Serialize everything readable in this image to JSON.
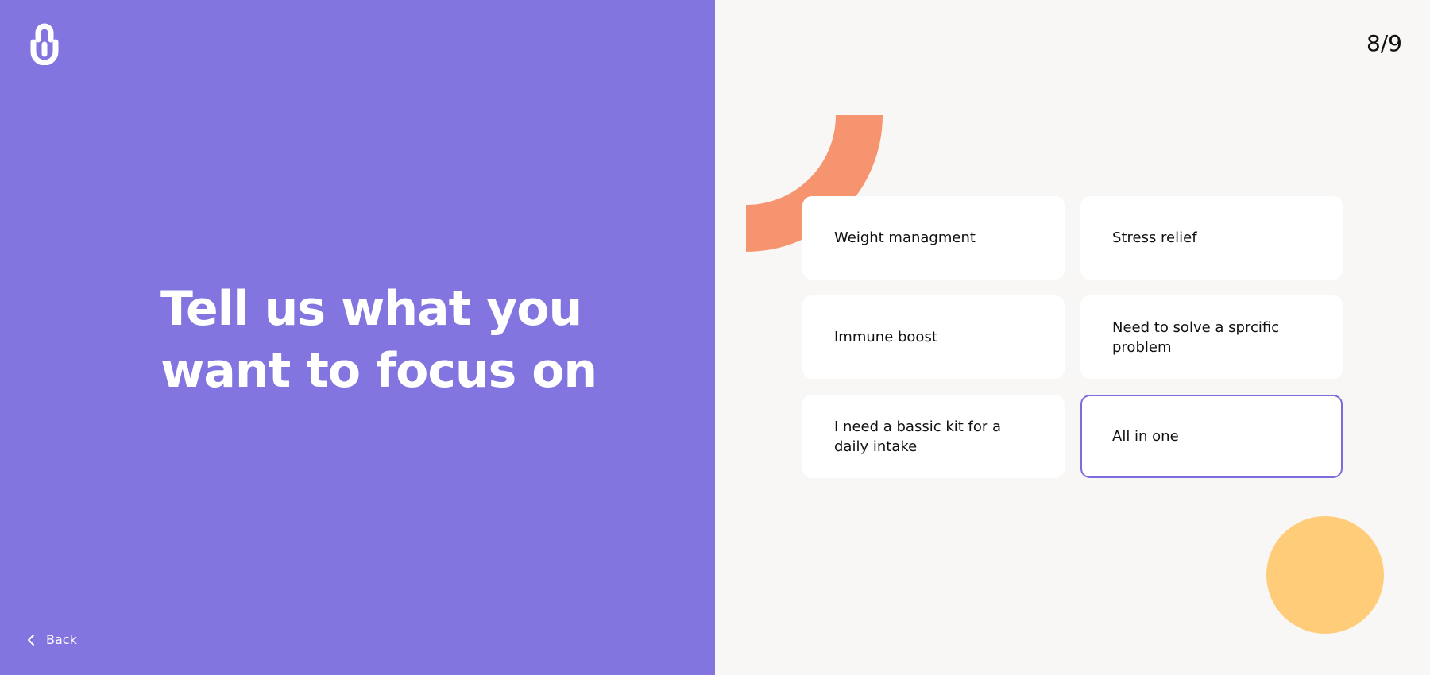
{
  "progress": {
    "text": "8/9"
  },
  "headline": {
    "line1": "Tell us what you",
    "line2": "want to focus on"
  },
  "back": {
    "label": "Back",
    "icon": "chevron-left-icon"
  },
  "logo": {
    "icon": "brand-logo-icon"
  },
  "colors": {
    "left_panel": "#8275df",
    "right_panel": "#f8f7f5",
    "card_border_selected": "#7b6bdc",
    "deco_orange": "#f79470",
    "deco_yellow": "#ffcc79"
  },
  "options": [
    {
      "label": "Weight managment",
      "selected": false
    },
    {
      "label": "Stress relief",
      "selected": false
    },
    {
      "label": "Immune boost",
      "selected": false
    },
    {
      "label": "Need to solve a sprcific problem",
      "selected": false
    },
    {
      "label": "I need a bassic kit for a daily intake",
      "selected": false
    },
    {
      "label": "All in one",
      "selected": true
    }
  ]
}
